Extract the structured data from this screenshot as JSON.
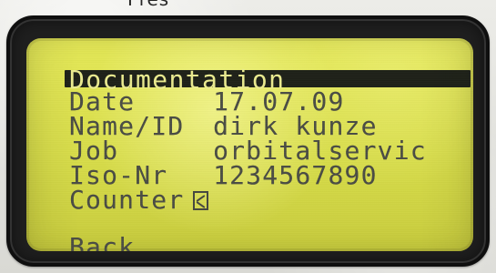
{
  "device": {
    "top_cut_text": "Pres"
  },
  "screen": {
    "title": "Documentation",
    "date_label": "Date",
    "date_value": "17.07.09",
    "name_label": "Name/ID",
    "name_value": "dirk kunze",
    "job_label": "Job",
    "job_value": "orbitalservic",
    "iso_label": "Iso-Nr",
    "iso_value": "1234567890",
    "counter_label": "Counter",
    "counter_state": "checked",
    "back_label": "Back"
  },
  "colors": {
    "lcd": "#dfe34f",
    "text": "#4a4c44",
    "highlight_bg": "#1e2118",
    "highlight_text": "#e9e98f",
    "bezel": "#1f1f1f"
  },
  "icons": {
    "counter_checkbox": "checkbox-icon"
  }
}
